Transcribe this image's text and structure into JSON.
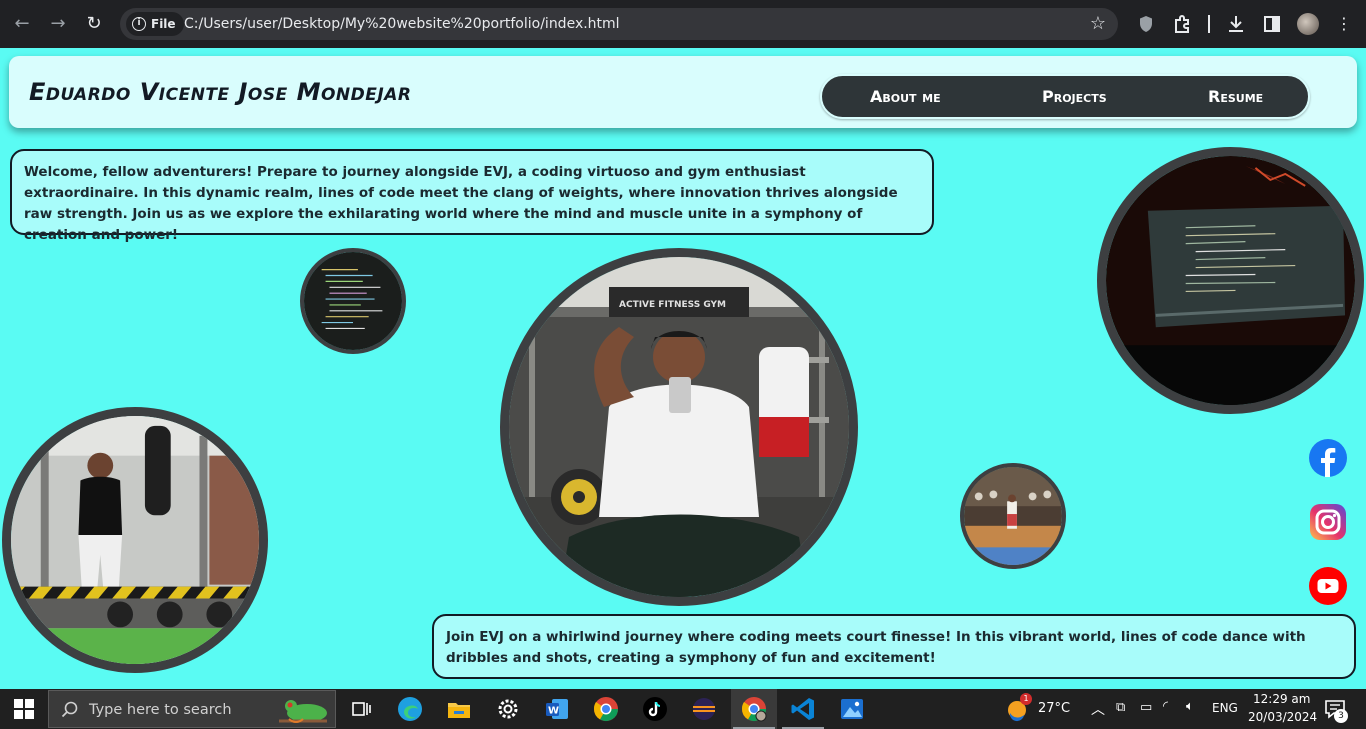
{
  "browser": {
    "file_chip": "File",
    "url": "C:/Users/user/Desktop/My%20website%20portfolio/index.html"
  },
  "header": {
    "site_title": "Eduardo Vicente Jose Mondejar",
    "nav": [
      "About me",
      "Projects",
      "Resume"
    ]
  },
  "bubbles": {
    "intro": "Welcome, fellow adventurers! Prepare to journey alongside EVJ, a coding virtuoso and gym enthusiast extraordinaire. In this dynamic realm, lines of code meet the clang of weights, where innovation thrives alongside raw strength. Join us as we explore the exhilarating world where the mind and muscle unite in a symphony of creation and power!",
    "court": "Join EVJ on a whirlwind journey where coding meets court finesse! In this vibrant world, lines of code dance with dribbles and shots, creating a symphony of fun and excitement!"
  },
  "photos": {
    "gym_sign": "ACTIVE FITNESS GYM"
  },
  "social": [
    "facebook-icon",
    "instagram-icon",
    "youtube-icon"
  ],
  "taskbar": {
    "search_placeholder": "Type here to search",
    "weather": "27°C",
    "weather_badge": "1",
    "language": "ENG",
    "time": "12:29 am",
    "date": "20/03/2024",
    "notifications": "3"
  },
  "colors": {
    "page_background": "#5afbf3",
    "nav_pill": "#2e3538",
    "bubble_background": "#a8fcfa",
    "header_background": "#d9fdfd"
  }
}
